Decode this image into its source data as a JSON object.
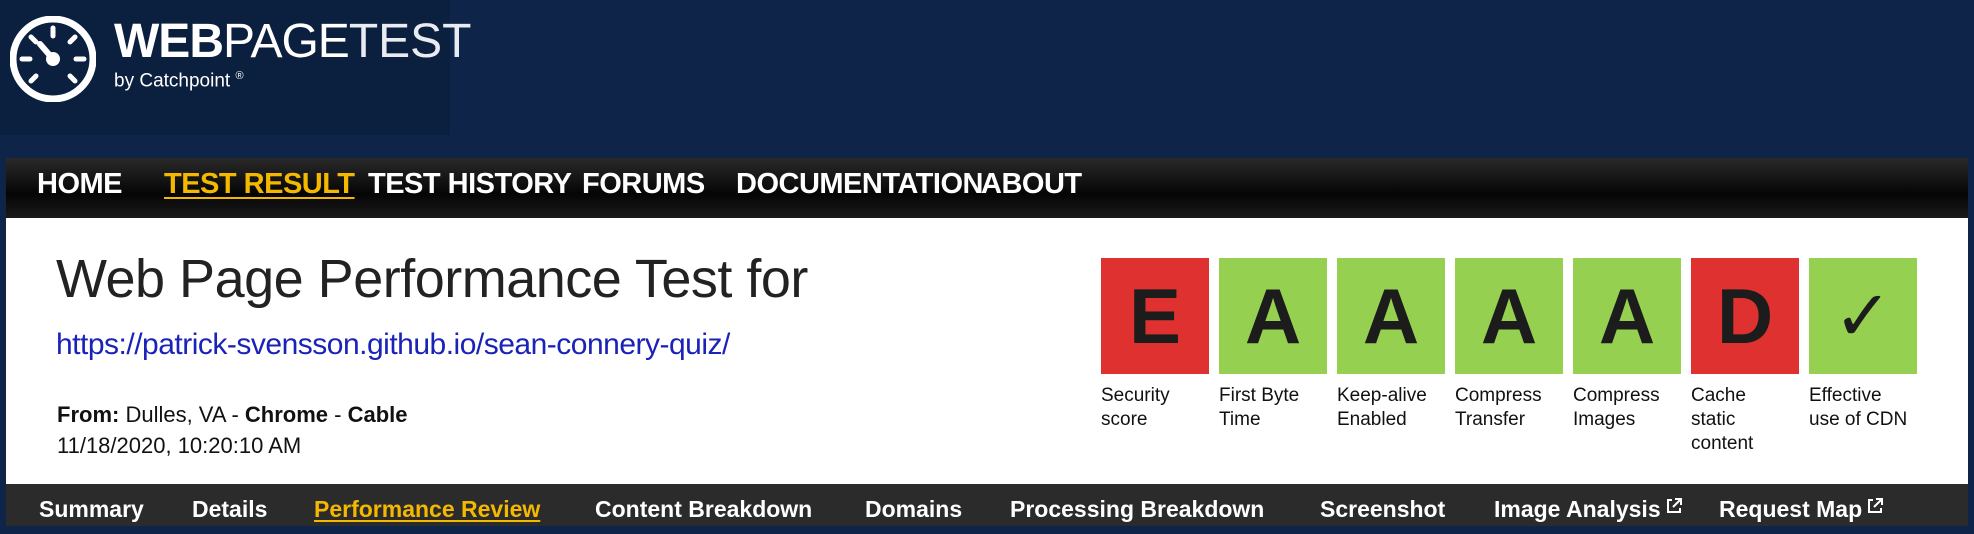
{
  "header": {
    "logo_word_bold": "WEB",
    "logo_word_mid": "PAGE",
    "logo_word_light": "TEST",
    "logo_sub": "by Catchpoint",
    "logo_reg": "®",
    "logo_icon": "speedometer-icon"
  },
  "nav": {
    "items": [
      {
        "label": "HOME",
        "active": false
      },
      {
        "label": "TEST RESULT",
        "active": true
      },
      {
        "label": "TEST HISTORY",
        "active": false
      },
      {
        "label": "FORUMS",
        "active": false
      },
      {
        "label": "DOCUMENTATION",
        "active": false
      },
      {
        "label": "ABOUT",
        "active": false
      }
    ]
  },
  "main": {
    "title": "Web Page Performance Test for",
    "url": "https://patrick-svensson.github.io/sean-connery-quiz/",
    "from_label": "From:",
    "location": "Dulles, VA",
    "separator": "-",
    "browser": "Chrome",
    "connection": "Cable",
    "date": "11/18/2020, 10:20:10 AM"
  },
  "grades": [
    {
      "grade": "E",
      "label_line1": "Security",
      "label_line2": "score",
      "label_line3": "",
      "color": "#e03131"
    },
    {
      "grade": "A",
      "label_line1": "First Byte",
      "label_line2": "Time",
      "label_line3": "",
      "color": "#96d050"
    },
    {
      "grade": "A",
      "label_line1": "Keep-alive",
      "label_line2": "Enabled",
      "label_line3": "",
      "color": "#96d050"
    },
    {
      "grade": "A",
      "label_line1": "Compress",
      "label_line2": "Transfer",
      "label_line3": "",
      "color": "#96d050"
    },
    {
      "grade": "A",
      "label_line1": "Compress",
      "label_line2": "Images",
      "label_line3": "",
      "color": "#96d050"
    },
    {
      "grade": "D",
      "label_line1": "Cache",
      "label_line2": "static",
      "label_line3": "content",
      "color": "#e03131"
    },
    {
      "grade": "✓",
      "label_line1": "Effective",
      "label_line2": "use of CDN",
      "label_line3": "",
      "color": "#96d050"
    }
  ],
  "tabs": [
    {
      "label": "Summary",
      "active": false,
      "external": false
    },
    {
      "label": "Details",
      "active": false,
      "external": false
    },
    {
      "label": "Performance Review",
      "active": true,
      "external": false
    },
    {
      "label": "Content Breakdown",
      "active": false,
      "external": false
    },
    {
      "label": "Domains",
      "active": false,
      "external": false
    },
    {
      "label": "Processing Breakdown",
      "active": false,
      "external": false
    },
    {
      "label": "Screenshot",
      "active": false,
      "external": false
    },
    {
      "label": "Image Analysis",
      "active": false,
      "external": true
    },
    {
      "label": "Request Map",
      "active": false,
      "external": true
    }
  ],
  "colors": {
    "header_bg": "#0e2448",
    "active_accent": "#f5b800",
    "grade_red": "#e03131",
    "grade_green": "#96d050",
    "url_link": "#1a22b8"
  }
}
